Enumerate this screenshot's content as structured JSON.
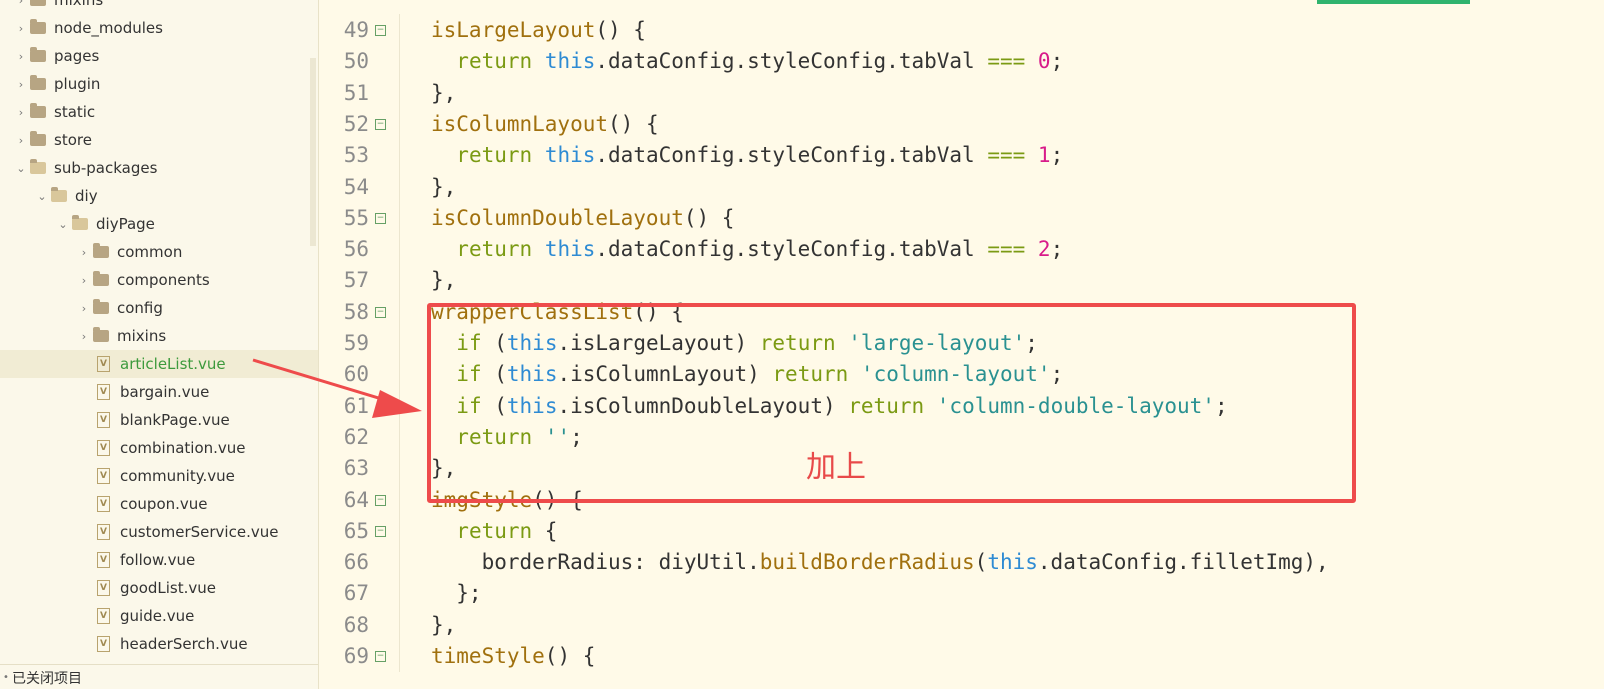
{
  "sidebar": {
    "items": [
      {
        "label": "mixins",
        "type": "folder",
        "open": false,
        "indent": 0
      },
      {
        "label": "node_modules",
        "type": "folder",
        "open": false,
        "indent": 0
      },
      {
        "label": "pages",
        "type": "folder",
        "open": false,
        "indent": 0
      },
      {
        "label": "plugin",
        "type": "folder",
        "open": false,
        "indent": 0
      },
      {
        "label": "static",
        "type": "folder",
        "open": false,
        "indent": 0
      },
      {
        "label": "store",
        "type": "folder",
        "open": false,
        "indent": 0
      },
      {
        "label": "sub-packages",
        "type": "folder",
        "open": true,
        "indent": 0
      },
      {
        "label": "diy",
        "type": "folder",
        "open": true,
        "indent": 1
      },
      {
        "label": "diyPage",
        "type": "folder",
        "open": true,
        "indent": 2
      },
      {
        "label": "common",
        "type": "folder",
        "open": false,
        "indent": 3
      },
      {
        "label": "components",
        "type": "folder",
        "open": false,
        "indent": 3
      },
      {
        "label": "config",
        "type": "folder",
        "open": false,
        "indent": 3
      },
      {
        "label": "mixins",
        "type": "folder",
        "open": false,
        "indent": 3
      },
      {
        "label": "articleList.vue",
        "type": "file",
        "selected": true,
        "indent": 3
      },
      {
        "label": "bargain.vue",
        "type": "file",
        "indent": 3
      },
      {
        "label": "blankPage.vue",
        "type": "file",
        "indent": 3
      },
      {
        "label": "combination.vue",
        "type": "file",
        "indent": 3
      },
      {
        "label": "community.vue",
        "type": "file",
        "indent": 3
      },
      {
        "label": "coupon.vue",
        "type": "file",
        "indent": 3
      },
      {
        "label": "customerService.vue",
        "type": "file",
        "indent": 3
      },
      {
        "label": "follow.vue",
        "type": "file",
        "indent": 3
      },
      {
        "label": "goodList.vue",
        "type": "file",
        "indent": 3
      },
      {
        "label": "guide.vue",
        "type": "file",
        "indent": 3
      },
      {
        "label": "headerSerch.vue",
        "type": "file",
        "indent": 3
      }
    ],
    "closed_projects_label": "已关闭项目"
  },
  "editor": {
    "accent_color": "#2fb36e",
    "lines": [
      {
        "num": "49",
        "fold": true,
        "tokens": [
          [
            "fn",
            "isLargeLayout"
          ],
          [
            "p",
            "() {"
          ]
        ]
      },
      {
        "num": "50",
        "fold": false,
        "tokens": [
          [
            "p",
            "  "
          ],
          [
            "kw",
            "return"
          ],
          [
            "p",
            " "
          ],
          [
            "this",
            "this"
          ],
          [
            "p",
            ".dataConfig.styleConfig.tabVal "
          ],
          [
            "op",
            "==="
          ],
          [
            "p",
            " "
          ],
          [
            "num",
            "0"
          ],
          [
            "p",
            ";"
          ]
        ]
      },
      {
        "num": "51",
        "fold": false,
        "tokens": [
          [
            "p",
            "},"
          ]
        ]
      },
      {
        "num": "52",
        "fold": true,
        "tokens": [
          [
            "fn",
            "isColumnLayout"
          ],
          [
            "p",
            "() {"
          ]
        ]
      },
      {
        "num": "53",
        "fold": false,
        "tokens": [
          [
            "p",
            "  "
          ],
          [
            "kw",
            "return"
          ],
          [
            "p",
            " "
          ],
          [
            "this",
            "this"
          ],
          [
            "p",
            ".dataConfig.styleConfig.tabVal "
          ],
          [
            "op",
            "==="
          ],
          [
            "p",
            " "
          ],
          [
            "num",
            "1"
          ],
          [
            "p",
            ";"
          ]
        ]
      },
      {
        "num": "54",
        "fold": false,
        "tokens": [
          [
            "p",
            "},"
          ]
        ]
      },
      {
        "num": "55",
        "fold": true,
        "tokens": [
          [
            "fn",
            "isColumnDoubleLayout"
          ],
          [
            "p",
            "() {"
          ]
        ]
      },
      {
        "num": "56",
        "fold": false,
        "tokens": [
          [
            "p",
            "  "
          ],
          [
            "kw",
            "return"
          ],
          [
            "p",
            " "
          ],
          [
            "this",
            "this"
          ],
          [
            "p",
            ".dataConfig.styleConfig.tabVal "
          ],
          [
            "op",
            "==="
          ],
          [
            "p",
            " "
          ],
          [
            "num",
            "2"
          ],
          [
            "p",
            ";"
          ]
        ]
      },
      {
        "num": "57",
        "fold": false,
        "tokens": [
          [
            "p",
            "},"
          ]
        ]
      },
      {
        "num": "58",
        "fold": true,
        "tokens": [
          [
            "fn",
            "wrapperClassList"
          ],
          [
            "p",
            "() {"
          ]
        ]
      },
      {
        "num": "59",
        "fold": false,
        "tokens": [
          [
            "p",
            "  "
          ],
          [
            "kw",
            "if"
          ],
          [
            "p",
            " ("
          ],
          [
            "this",
            "this"
          ],
          [
            "p",
            ".isLargeLayout) "
          ],
          [
            "kw",
            "return"
          ],
          [
            "p",
            " "
          ],
          [
            "str",
            "'large-layout'"
          ],
          [
            "p",
            ";"
          ]
        ]
      },
      {
        "num": "60",
        "fold": false,
        "tokens": [
          [
            "p",
            "  "
          ],
          [
            "kw",
            "if"
          ],
          [
            "p",
            " ("
          ],
          [
            "this",
            "this"
          ],
          [
            "p",
            ".isColumnLayout) "
          ],
          [
            "kw",
            "return"
          ],
          [
            "p",
            " "
          ],
          [
            "str",
            "'column-layout'"
          ],
          [
            "p",
            ";"
          ]
        ]
      },
      {
        "num": "61",
        "fold": false,
        "tokens": [
          [
            "p",
            "  "
          ],
          [
            "kw",
            "if"
          ],
          [
            "p",
            " ("
          ],
          [
            "this",
            "this"
          ],
          [
            "p",
            ".isColumnDoubleLayout) "
          ],
          [
            "kw",
            "return"
          ],
          [
            "p",
            " "
          ],
          [
            "str",
            "'column-double-layout'"
          ],
          [
            "p",
            ";"
          ]
        ]
      },
      {
        "num": "62",
        "fold": false,
        "tokens": [
          [
            "p",
            "  "
          ],
          [
            "kw",
            "return"
          ],
          [
            "p",
            " "
          ],
          [
            "str",
            "''"
          ],
          [
            "p",
            ";"
          ]
        ]
      },
      {
        "num": "63",
        "fold": false,
        "tokens": [
          [
            "p",
            "},"
          ]
        ]
      },
      {
        "num": "64",
        "fold": true,
        "tokens": [
          [
            "fn",
            "imgStyle"
          ],
          [
            "p",
            "() {"
          ]
        ]
      },
      {
        "num": "65",
        "fold": true,
        "tokens": [
          [
            "p",
            "  "
          ],
          [
            "kw",
            "return"
          ],
          [
            "p",
            " {"
          ]
        ]
      },
      {
        "num": "66",
        "fold": false,
        "tokens": [
          [
            "p",
            "    borderRadius: diyUtil."
          ],
          [
            "fn",
            "buildBorderRadius"
          ],
          [
            "p",
            "("
          ],
          [
            "this",
            "this"
          ],
          [
            "p",
            ".dataConfig.filletImg),"
          ]
        ]
      },
      {
        "num": "67",
        "fold": false,
        "tokens": [
          [
            "p",
            "  };"
          ]
        ]
      },
      {
        "num": "68",
        "fold": false,
        "tokens": [
          [
            "p",
            "},"
          ]
        ]
      },
      {
        "num": "69",
        "fold": true,
        "tokens": [
          [
            "fn",
            "timeStyle"
          ],
          [
            "p",
            "() {"
          ]
        ]
      }
    ]
  },
  "annotation": {
    "text": "加上",
    "color": "#ee4b4b"
  }
}
